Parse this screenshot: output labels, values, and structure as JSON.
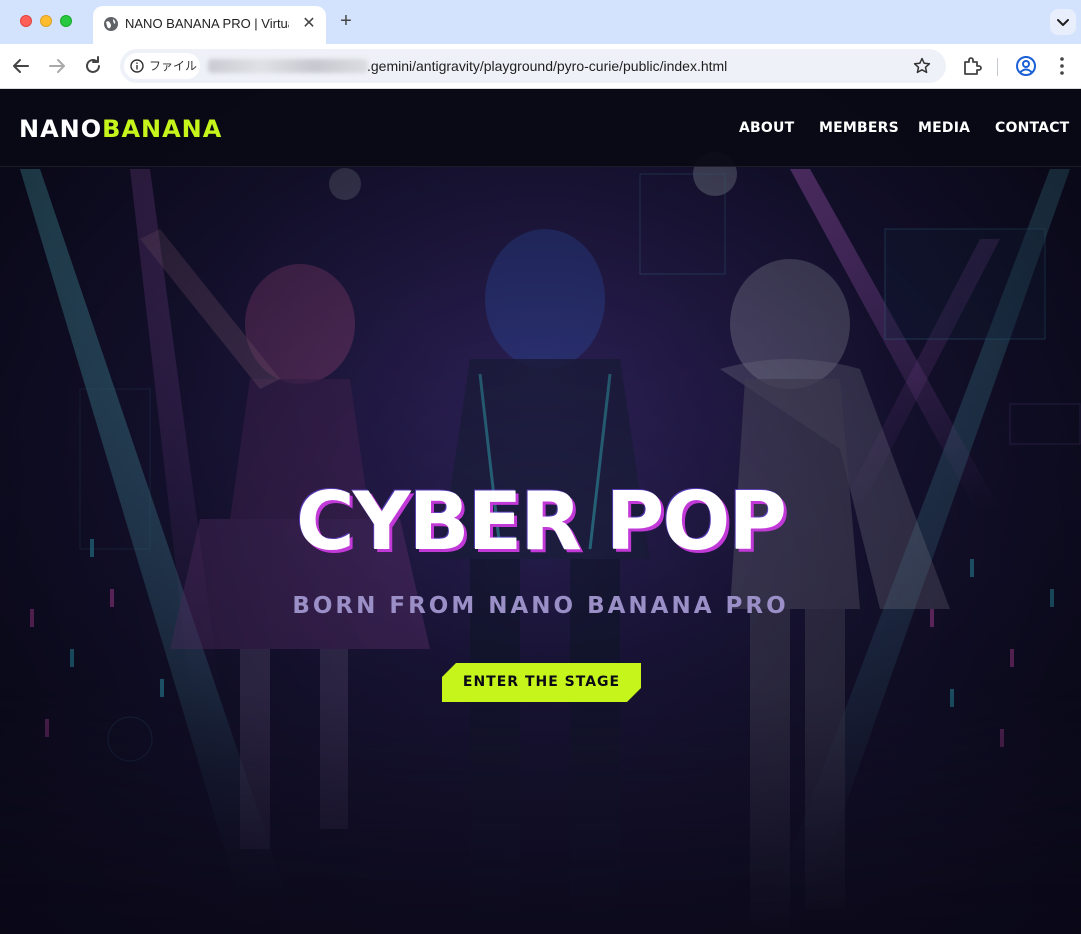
{
  "browser": {
    "tab_title": "NANO BANANA PRO | Virtual",
    "new_tab_symbol": "+",
    "tab_close_symbol": "✕",
    "site_info_label": "ファイル",
    "url_visible": ".gemini/antigravity/playground/pyro-curie/public/index.html"
  },
  "site": {
    "logo_part1": "NANO",
    "logo_part2": "BANANA",
    "nav": [
      "ABOUT",
      "MEMBERS",
      "MEDIA",
      "CONTACT"
    ],
    "hero_title": "CYBER POP",
    "hero_subtitle": "BORN FROM NANO BANANA PRO",
    "cta_label": "ENTER THE STAGE"
  },
  "colors": {
    "accent": "#c6f51c",
    "title_shadow": "#c13ad8",
    "subtitle": "#9a8fc6",
    "nav_bg": "#0a0a16",
    "browser_frame": "#d3e3fd"
  }
}
